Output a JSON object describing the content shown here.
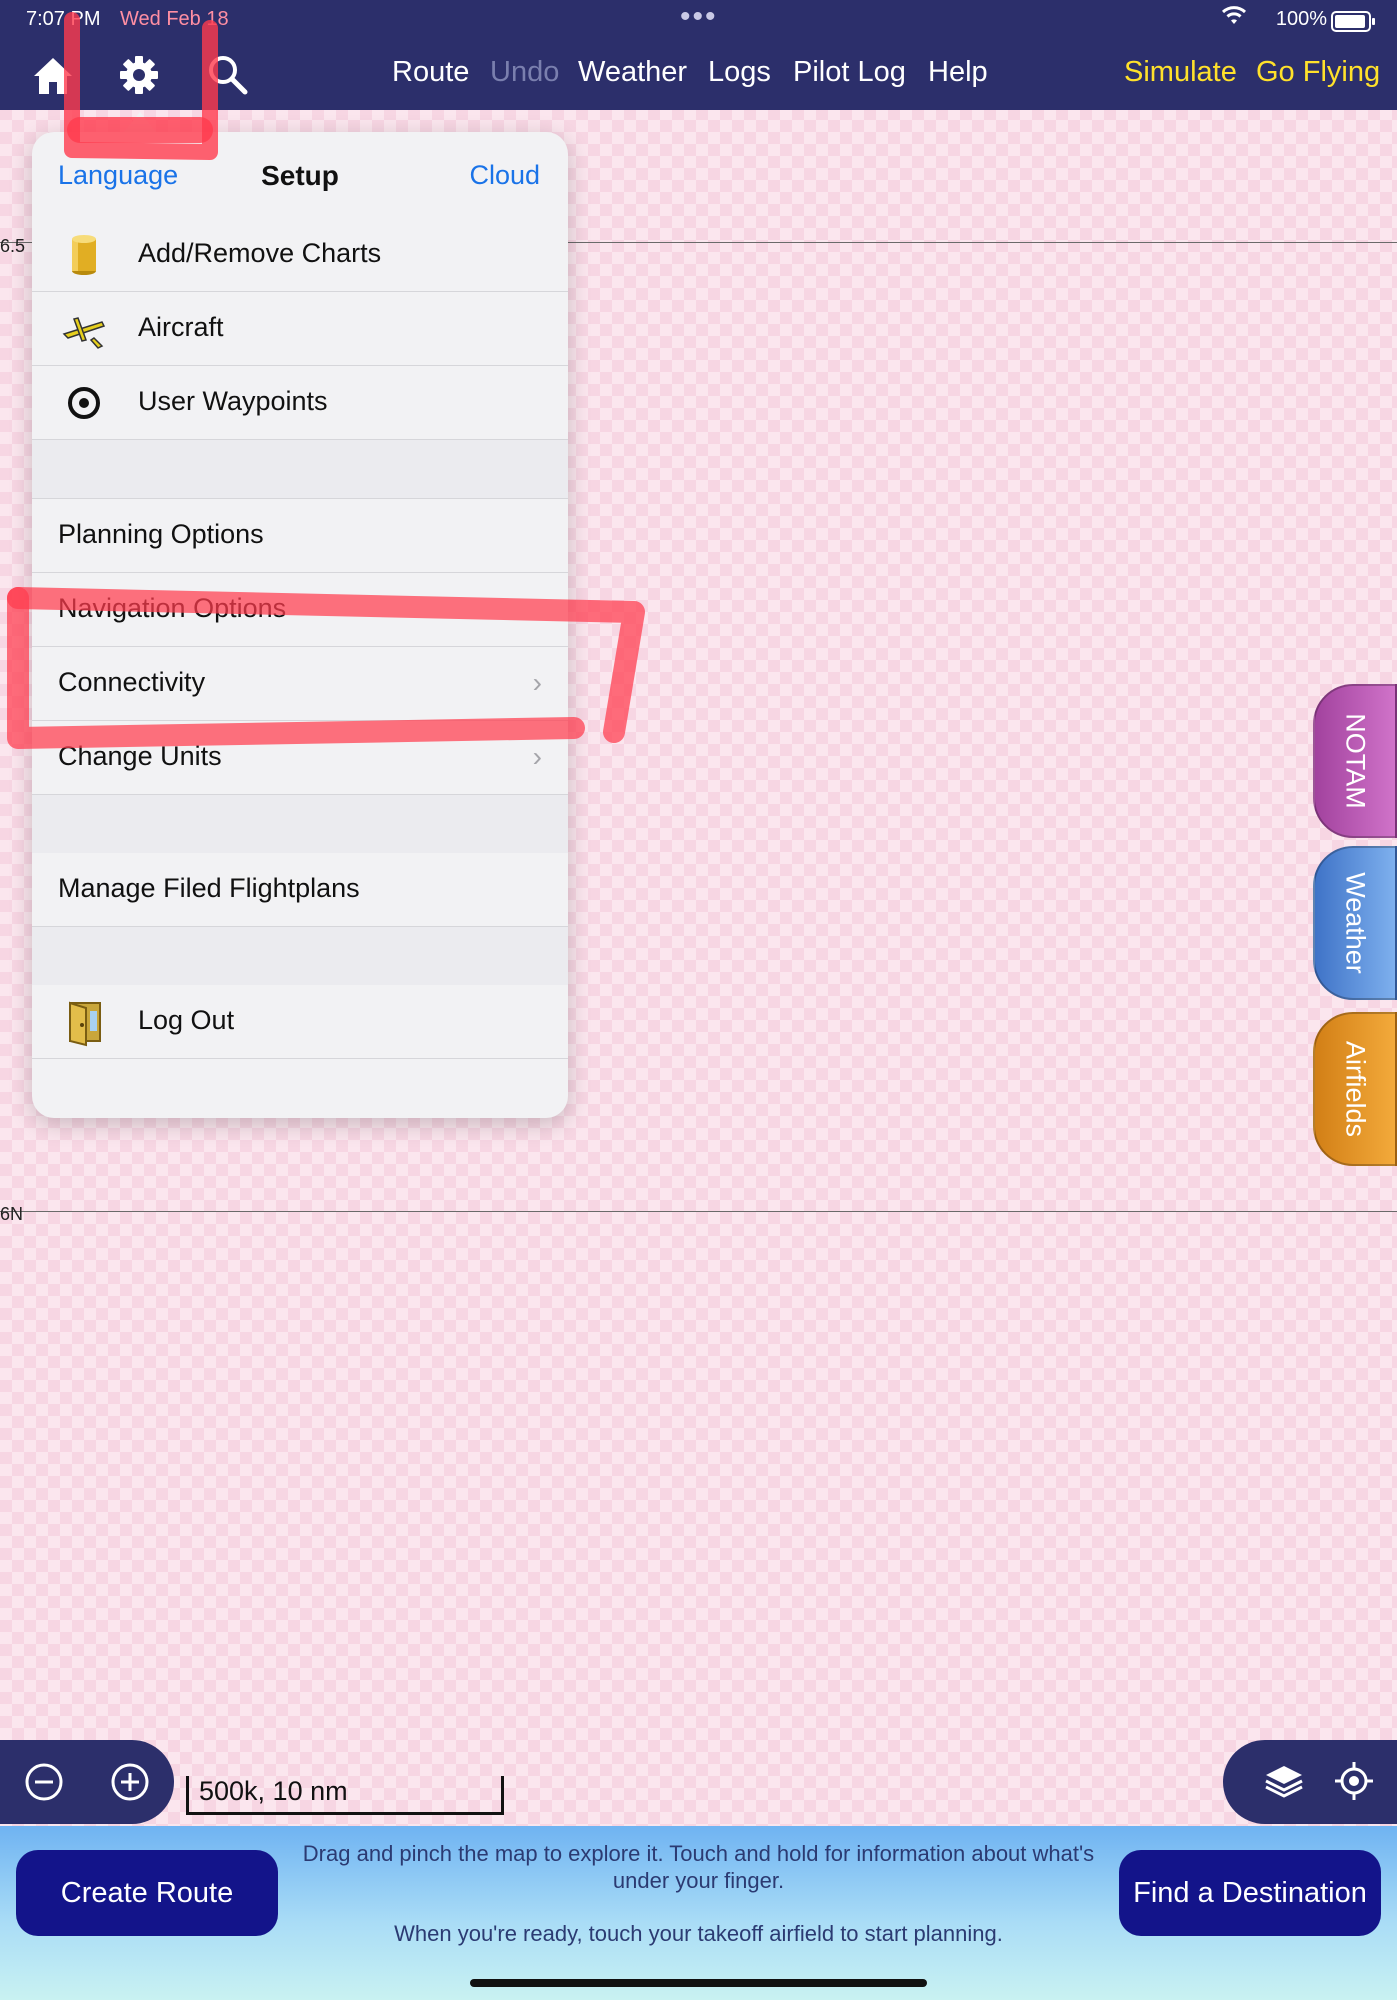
{
  "status_bar": {
    "time": "7:07 PM",
    "date": "Wed Feb 18",
    "battery": "100%"
  },
  "nav": {
    "route": "Route",
    "undo": "Undo",
    "weather": "Weather",
    "logs": "Logs",
    "pilot_log": "Pilot Log",
    "help": "Help",
    "simulate": "Simulate",
    "go_flying": "Go Flying"
  },
  "map": {
    "lat_top": "6.5",
    "lat_mid": "6N"
  },
  "setup": {
    "language": "Language",
    "title": "Setup",
    "cloud": "Cloud",
    "items": [
      {
        "label": "Add/Remove Charts",
        "icon": "chart-cylinder-icon"
      },
      {
        "label": "Aircraft",
        "icon": "aircraft-icon"
      },
      {
        "label": "User Waypoints",
        "icon": "waypoint-icon"
      },
      {
        "label": "Planning Options"
      },
      {
        "label": "Navigation Options"
      },
      {
        "label": "Connectivity",
        "chevron": true
      },
      {
        "label": "Change Units",
        "chevron": true
      },
      {
        "label": "Manage Filed Flightplans"
      },
      {
        "label": "Log Out",
        "icon": "logout-door-icon"
      }
    ]
  },
  "side_tabs": {
    "notam": "NOTAM",
    "weather": "Weather",
    "airfields": "Airfields"
  },
  "scale": "500k, 10 nm",
  "bottom": {
    "create_route": "Create Route",
    "find_destination": "Find a Destination",
    "hint_line1": "Drag and pinch the map to explore it. Touch and hold for information about what's under your finger.",
    "hint_line2": "When you're ready, touch your takeoff airfield to start planning."
  },
  "colors": {
    "nav_bar": "#2c2f6b",
    "accent_yellow": "#ffe12b",
    "link_blue": "#1a73e8",
    "button_navy": "#13148a",
    "annotation_red": "#ff3b4e"
  }
}
